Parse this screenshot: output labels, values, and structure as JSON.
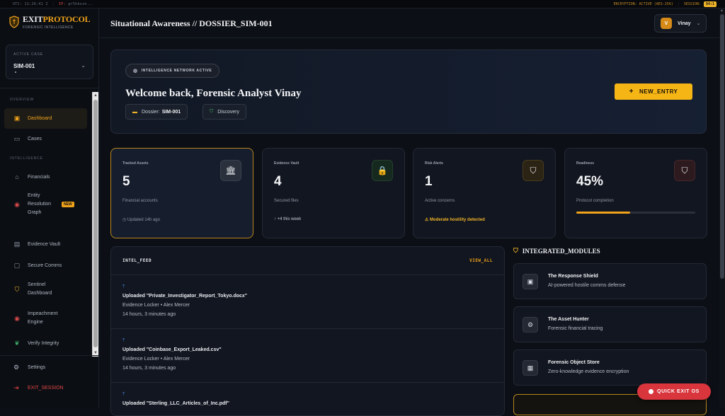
{
  "topbar": {
    "utc": "UTC: 11:26:41 Z",
    "ip_label": "IP:",
    "ip_value": "gr5hkxvn...",
    "encryption": "ENCRYPTION: ACTIVE (AES-256)",
    "session_label": "SESSION:",
    "session_badge": "84:1"
  },
  "brand": {
    "name_a": "EXIT",
    "name_b": "PROTOCOL",
    "tagline": "FORENSIC INTELLIGENCE",
    "accent": "#f0a21a"
  },
  "active_case": {
    "label": "ACTIVE CASE",
    "value": "SIM-001"
  },
  "sidebar": {
    "sections": [
      "OVERVIEW",
      "INTELLIGENCE"
    ],
    "items": [
      {
        "label": "Dashboard",
        "icon": "dashboard-icon",
        "active": true
      },
      {
        "label": "Cases",
        "icon": "briefcase-icon"
      },
      {
        "label": "Financials",
        "icon": "bank-icon"
      },
      {
        "label": "Entity Resolution Graph",
        "icon": "target-icon",
        "badge": "NEW"
      },
      {
        "label": "Evidence Vault",
        "icon": "document-icon"
      },
      {
        "label": "Secure Comms",
        "icon": "message-icon"
      },
      {
        "label": "Sentinel Dashboard",
        "icon": "shield-icon"
      },
      {
        "label": "Impeachment Engine",
        "icon": "target-icon"
      },
      {
        "label": "Verify Integrity",
        "icon": "leaf-icon"
      }
    ],
    "settings": "Settings",
    "exit": "EXIT_SESSION"
  },
  "header": {
    "title": "Situational Awareness // DOSSIER_SIM-001",
    "user_initial": "V",
    "user_name": "Vinay"
  },
  "welcome": {
    "pill": "INTELLIGENCE NETWORK ACTIVE",
    "title": "Welcome back, Forensic Analyst Vinay",
    "dossier_label": "Dossier:",
    "dossier_value": "SIM-001",
    "phase": "Discovery",
    "new_entry": "NEW_ENTRY"
  },
  "stats": [
    {
      "label": "Tracked Assets",
      "value": "5",
      "sub": "Financial accounts",
      "footer": "Updated 14h ago",
      "icon": "bank-icon"
    },
    {
      "label": "Evidence Vault",
      "value": "4",
      "sub": "Secured files",
      "footer": "+4 this week",
      "icon": "lock-file-icon"
    },
    {
      "label": "Risk Alerts",
      "value": "1",
      "sub": "Active concerns",
      "footer": "Moderate hostility detected",
      "icon": "alert-shield-icon"
    },
    {
      "label": "Readiness",
      "value": "45%",
      "sub": "Protocol completion",
      "progress": 0.45,
      "icon": "check-shield-icon"
    }
  ],
  "feed": {
    "title": "INTEL_FEED",
    "view_all": "VIEW_ALL",
    "items": [
      {
        "title": "Uploaded \"Private_Investigator_Report_Tokyo.docx\"",
        "meta": "Evidence Locker • Alex Mercer",
        "time": "14 hours, 3 minutes ago"
      },
      {
        "title": "Uploaded \"Coinbase_Export_Leaked.csv\"",
        "meta": "Evidence Locker • Alex Mercer",
        "time": "14 hours, 3 minutes ago"
      },
      {
        "title": "Uploaded \"Sterling_LLC_Articles_of_Inc.pdf\"",
        "meta": "",
        "time": ""
      }
    ]
  },
  "modules": {
    "title": "INTEGRATED_MODULES",
    "items": [
      {
        "name": "The Response Shield",
        "desc": "AI-powered hostile comms defense",
        "icon": "chat-shield-icon"
      },
      {
        "name": "The Asset Hunter",
        "desc": "Forensic financial tracing",
        "icon": "chip-icon"
      },
      {
        "name": "Forensic Object Store",
        "desc": "Zero-knowledge evidence encryption",
        "icon": "vault-icon"
      }
    ]
  },
  "quick_exit": "QUICK EXIT OS"
}
